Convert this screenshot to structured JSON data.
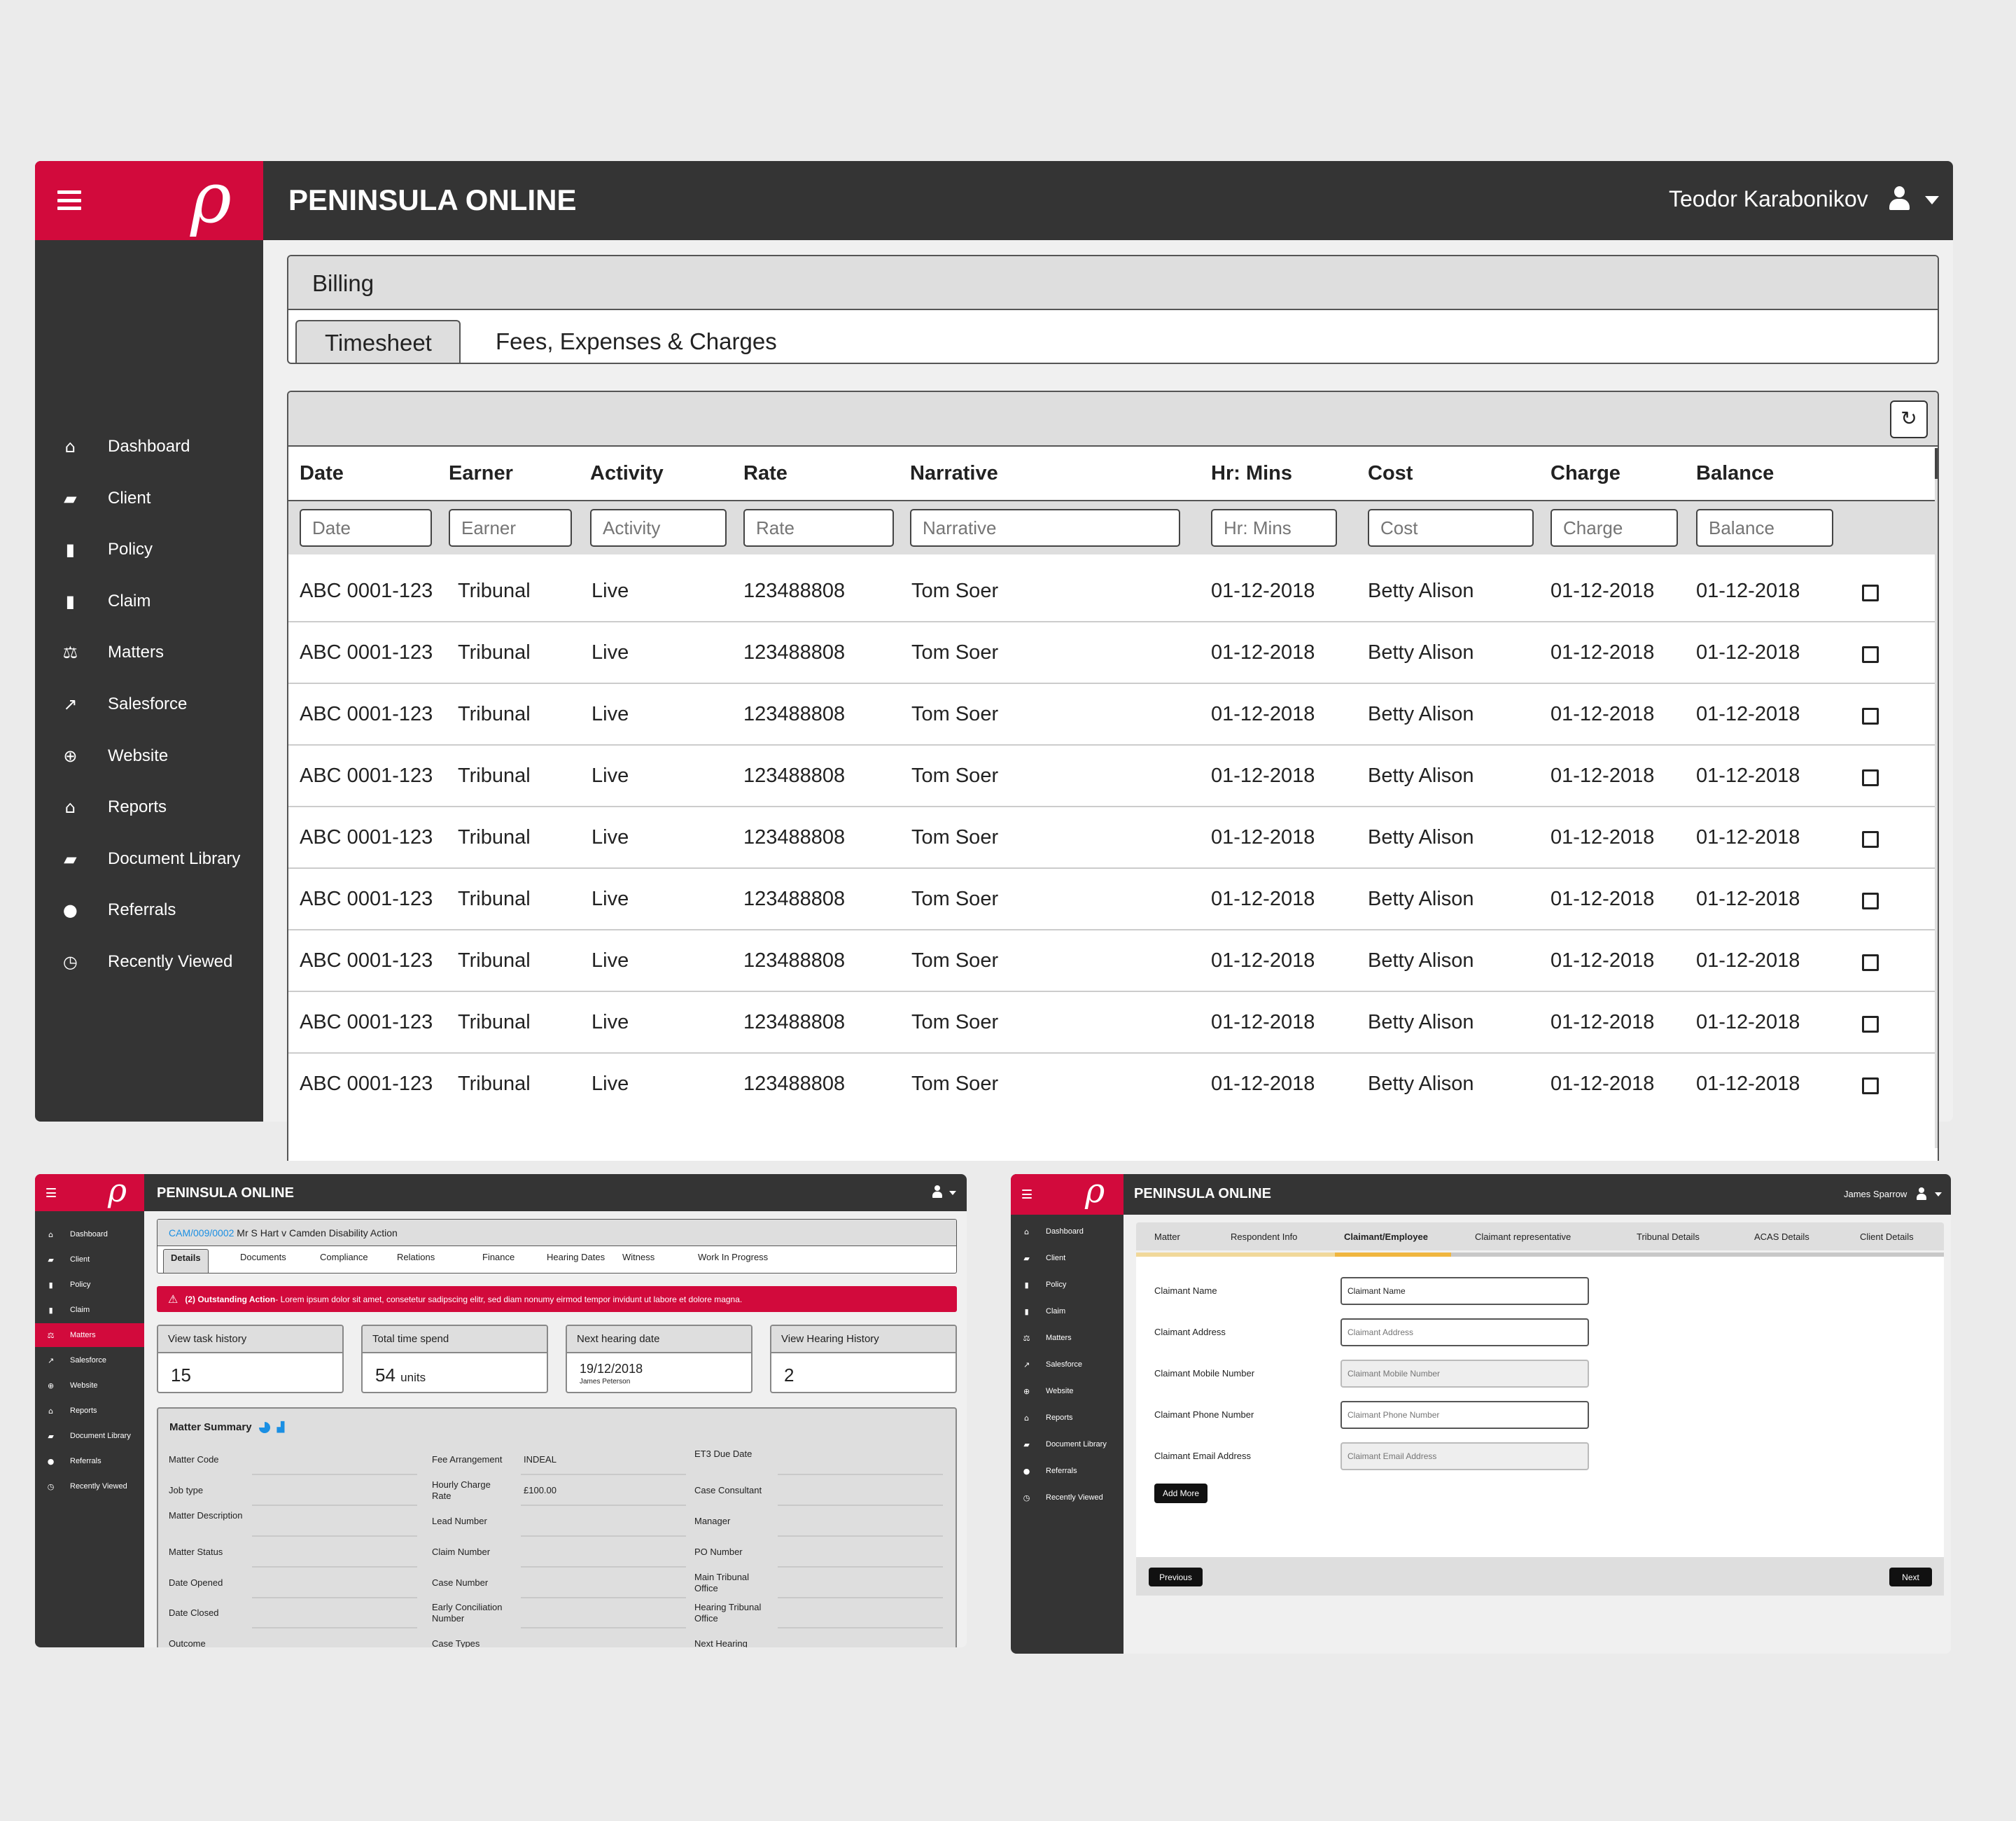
{
  "brand_color": "#d20a3c",
  "nav_items": [
    {
      "label": "Dashboard",
      "icon": "home-icon"
    },
    {
      "label": "Client",
      "icon": "folder-open-icon"
    },
    {
      "label": "Policy",
      "icon": "file-icon"
    },
    {
      "label": "Claim",
      "icon": "clipboard-icon"
    },
    {
      "label": "Matters",
      "icon": "scales-icon"
    },
    {
      "label": "Salesforce",
      "icon": "line-chart-icon"
    },
    {
      "label": "Website",
      "icon": "globe-icon"
    },
    {
      "label": "Reports",
      "icon": "home-icon"
    },
    {
      "label": "Document Library",
      "icon": "folder-open-icon"
    },
    {
      "label": "Referrals",
      "icon": "comments-icon"
    },
    {
      "label": "Recently Viewed",
      "icon": "clock-icon"
    }
  ],
  "main": {
    "app_title": "PENINSULA ONLINE",
    "user_name": "Teodor Karabonikov",
    "section_title": "Billing",
    "tabs": [
      {
        "label": "Timesheet",
        "active": true
      },
      {
        "label": "Fees, Expenses & Charges",
        "active": false
      }
    ],
    "columns": [
      "Date",
      "Earner",
      "Activity",
      "Rate",
      "Narrative",
      "Hr: Mins",
      "Cost",
      "Charge",
      "Balance"
    ],
    "filter_placeholders": [
      "Date",
      "Earner",
      "Activity",
      "Rate",
      "Narrative",
      "Hr: Mins",
      "Cost",
      "Charge",
      "Balance"
    ],
    "rows": [
      [
        "ABC 0001-123",
        "Tribunal",
        "Live",
        "123488808",
        "Tom Soer",
        "01-12-2018",
        "Betty Alison",
        "01-12-2018",
        "01-12-2018"
      ],
      [
        "ABC 0001-123",
        "Tribunal",
        "Live",
        "123488808",
        "Tom Soer",
        "01-12-2018",
        "Betty Alison",
        "01-12-2018",
        "01-12-2018"
      ],
      [
        "ABC 0001-123",
        "Tribunal",
        "Live",
        "123488808",
        "Tom Soer",
        "01-12-2018",
        "Betty Alison",
        "01-12-2018",
        "01-12-2018"
      ],
      [
        "ABC 0001-123",
        "Tribunal",
        "Live",
        "123488808",
        "Tom Soer",
        "01-12-2018",
        "Betty Alison",
        "01-12-2018",
        "01-12-2018"
      ],
      [
        "ABC 0001-123",
        "Tribunal",
        "Live",
        "123488808",
        "Tom Soer",
        "01-12-2018",
        "Betty Alison",
        "01-12-2018",
        "01-12-2018"
      ],
      [
        "ABC 0001-123",
        "Tribunal",
        "Live",
        "123488808",
        "Tom Soer",
        "01-12-2018",
        "Betty Alison",
        "01-12-2018",
        "01-12-2018"
      ],
      [
        "ABC 0001-123",
        "Tribunal",
        "Live",
        "123488808",
        "Tom Soer",
        "01-12-2018",
        "Betty Alison",
        "01-12-2018",
        "01-12-2018"
      ],
      [
        "ABC 0001-123",
        "Tribunal",
        "Live",
        "123488808",
        "Tom Soer",
        "01-12-2018",
        "Betty Alison",
        "01-12-2018",
        "01-12-2018"
      ],
      [
        "ABC 0001-123",
        "Tribunal",
        "Live",
        "123488808",
        "Tom Soer",
        "01-12-2018",
        "Betty Alison",
        "01-12-2018",
        "01-12-2018"
      ]
    ]
  },
  "matter": {
    "app_title": "PENINSULA ONLINE",
    "active_nav": "Matters",
    "case_ref": "CAM/009/0002",
    "case_title": "Mr S Hart v Camden Disability Action",
    "link_color": "#1a8fe3",
    "tabs": [
      "Details",
      "Documents",
      "Compliance",
      "Relations",
      "Finance",
      "Hearing Dates",
      "Witness",
      "Work In Progress"
    ],
    "alert_title": "(2) Outstanding Action",
    "alert_text": " - Lorem ipsum dolor sit amet, consetetur sadipscing elitr, sed diam nonumy eirmod tempor invidunt ut labore et dolore magna.",
    "cards": [
      {
        "title": "View task history",
        "value": "15",
        "unit": "",
        "sub": ""
      },
      {
        "title": "Total time spend",
        "value": "54",
        "unit": "units",
        "sub": ""
      },
      {
        "title": "Next hearing date",
        "value": "19/12/2018",
        "unit": "",
        "sub": "James Peterson"
      },
      {
        "title": "View Hearing History",
        "value": "2",
        "unit": "",
        "sub": ""
      }
    ],
    "summary_title": "Matter Summary",
    "summary": [
      [
        {
          "label": "Matter Code",
          "value": ""
        },
        {
          "label": "Fee Arrangement",
          "value": "INDEAL"
        },
        {
          "label": "ET3 Due Date",
          "value": ""
        }
      ],
      [
        {
          "label": "Job type",
          "value": ""
        },
        {
          "label": "Hourly Charge Rate",
          "value": "£100.00"
        },
        {
          "label": "Case Consultant",
          "value": ""
        }
      ],
      [
        {
          "label": "Matter Description",
          "value": ""
        },
        {
          "label": "Lead Number",
          "value": ""
        },
        {
          "label": "Manager",
          "value": ""
        }
      ],
      [
        {
          "label": "Matter Status",
          "value": ""
        },
        {
          "label": "Claim Number",
          "value": ""
        },
        {
          "label": "PO Number",
          "value": ""
        }
      ],
      [
        {
          "label": "Date Opened",
          "value": ""
        },
        {
          "label": "Case Number",
          "value": ""
        },
        {
          "label": "Main Tribunal Office",
          "value": ""
        }
      ],
      [
        {
          "label": "Date Closed",
          "value": ""
        },
        {
          "label": "Early Conciliation Number",
          "value": ""
        },
        {
          "label": "Hearing Tribunal Office",
          "value": ""
        }
      ],
      [
        {
          "label": "Outcome",
          "value": ""
        },
        {
          "label": "Case Types",
          "value": ""
        },
        {
          "label": "Next Hearing",
          "value": ""
        }
      ]
    ]
  },
  "claimant": {
    "app_title": "PENINSULA ONLINE",
    "user_name": "James Sparrow",
    "tabs": [
      {
        "label": "Matter"
      },
      {
        "label": "Respondent Info"
      },
      {
        "label": "Claimant/Employee",
        "active": true
      },
      {
        "label": "Claimant representative"
      },
      {
        "label": "Tribunal Details"
      },
      {
        "label": "ACAS Details"
      },
      {
        "label": "Client Details"
      }
    ],
    "progress_colors": {
      "done": "#f1d89a",
      "active": "#f0b63f",
      "todo": "#c8c8c8"
    },
    "fields": [
      {
        "label": "Claimant Name",
        "value": "Claimant Name",
        "placeholder": "Claimant Name",
        "disabled": false
      },
      {
        "label": "Claimant Address",
        "value": "",
        "placeholder": "Claimant Address",
        "disabled": false
      },
      {
        "label": "Claimant Mobile Number",
        "value": "",
        "placeholder": "Claimant Mobile Number",
        "disabled": true
      },
      {
        "label": "Claimant Phone Number",
        "value": "",
        "placeholder": "Claimant Phone Number",
        "disabled": false
      },
      {
        "label": "Claimant Email Address",
        "value": "",
        "placeholder": "Claimant Email Address",
        "disabled": true
      }
    ],
    "add_more": "Add More",
    "previous": "Previous",
    "next": "Next"
  }
}
